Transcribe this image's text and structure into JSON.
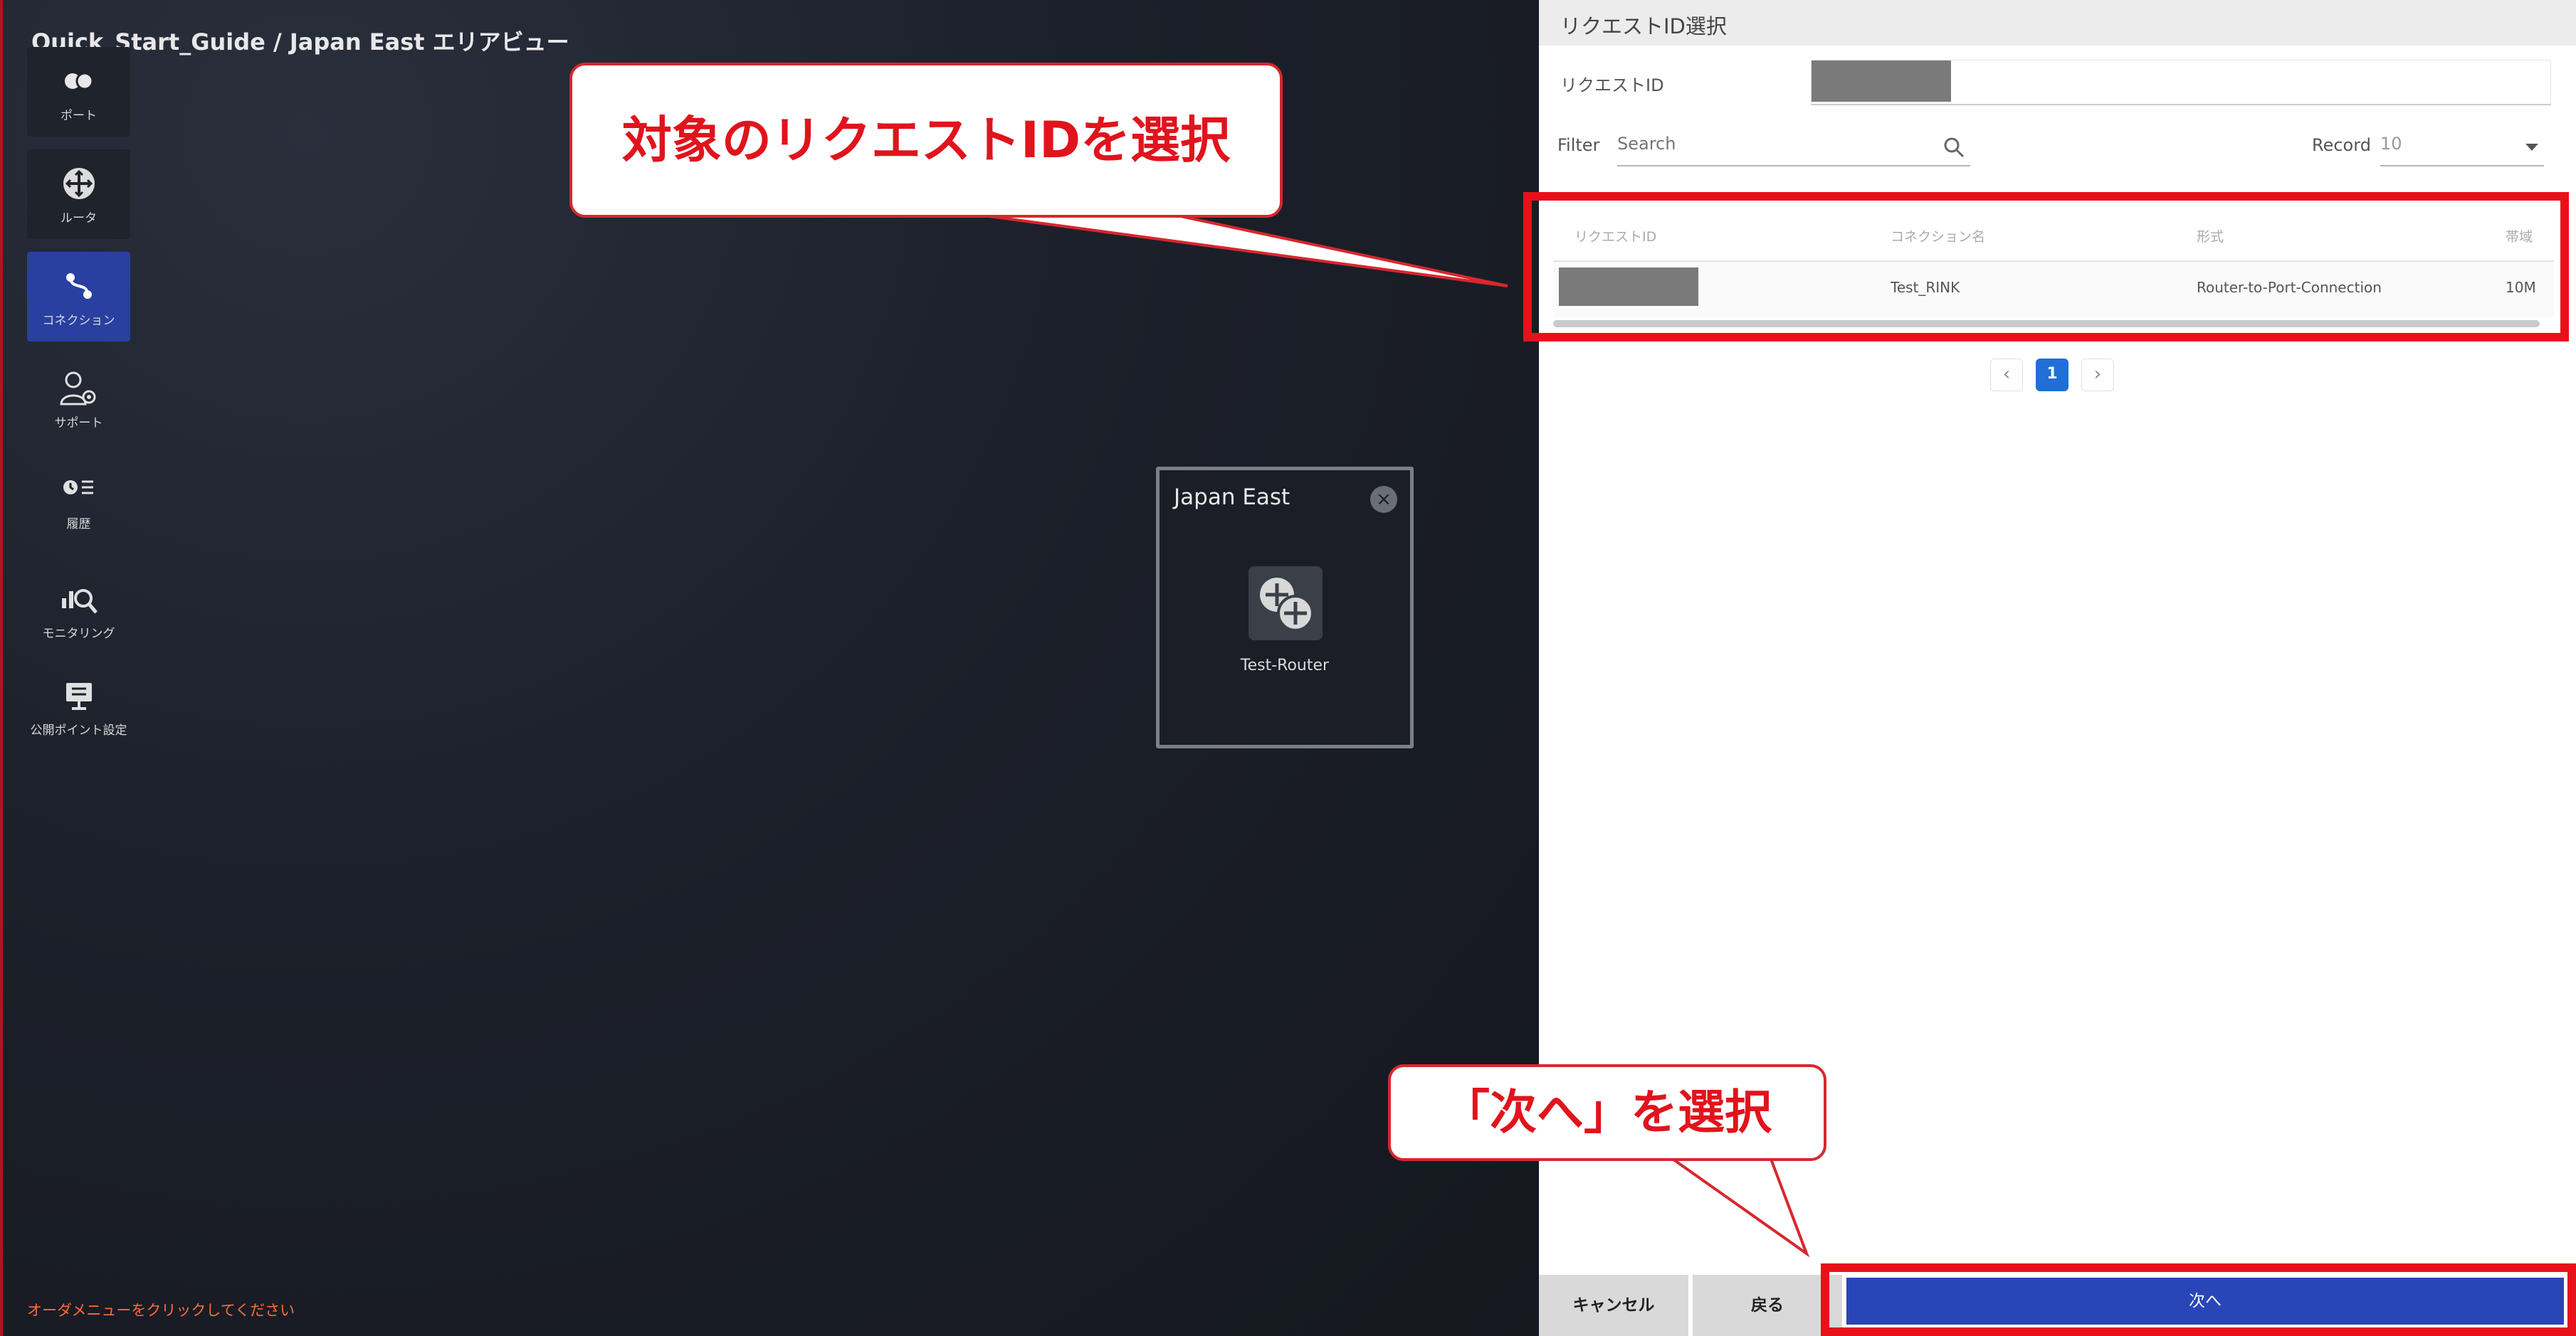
{
  "window": {
    "breadcrumb": "Quick_Start_Guide / Japan East エリアビュー"
  },
  "sidebar": {
    "items": [
      {
        "label": "ポート",
        "icon": "port-icon"
      },
      {
        "label": "ルータ",
        "icon": "router-icon"
      },
      {
        "label": "コネクション",
        "icon": "connection-icon",
        "active": true
      },
      {
        "label": "サポート",
        "icon": "support-icon"
      },
      {
        "label": "履歴",
        "icon": "history-icon"
      },
      {
        "label": "モニタリング",
        "icon": "monitoring-icon"
      },
      {
        "label": "公開ポイント設定",
        "icon": "public-point-icon"
      }
    ]
  },
  "status": {
    "message": "オーダメニューをクリックしてください"
  },
  "area_popup": {
    "title": "Japan East",
    "router_label": "Test-Router"
  },
  "panel": {
    "title": "リクエストID選択",
    "request_id_label": "リクエストID",
    "filter_label": "Filter",
    "search_placeholder": "Search",
    "record_label": "Record",
    "record_value": "10",
    "table": {
      "columns": [
        "リクエストID",
        "コネクション名",
        "形式",
        "帯域"
      ],
      "rows": [
        {
          "request_id": "",
          "connection_name": "Test_RINK",
          "type": "Router-to-Port-Connection",
          "bandwidth": "10M"
        }
      ]
    },
    "pagination": {
      "prev": "‹",
      "current": "1",
      "next": "›"
    }
  },
  "footer": {
    "cancel_label": "キャンセル",
    "back_label": "戻る",
    "next_label": "次へ"
  },
  "annotations": {
    "callout_select_id": "対象のリクエストIDを選択",
    "callout_next": "「次へ」を選択",
    "highlight_color": "#e8111a"
  },
  "colors": {
    "accent_blue": "#2946b8",
    "sidebar_active": "#2940a0",
    "status_orange": "#ff6a3d"
  }
}
